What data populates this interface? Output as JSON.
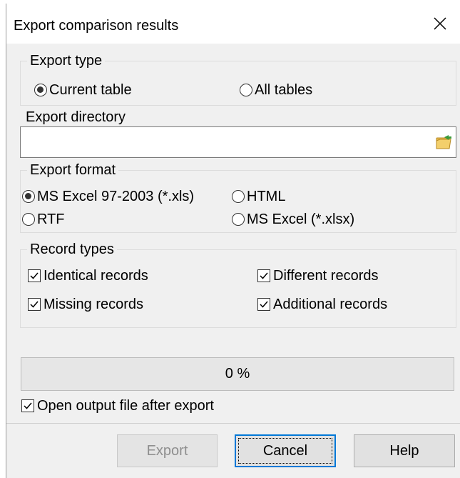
{
  "dialog": {
    "title": "Export comparison results"
  },
  "export_type": {
    "legend": "Export type",
    "options": [
      {
        "label": "Current table",
        "selected": true
      },
      {
        "label": "All tables",
        "selected": false
      }
    ]
  },
  "export_directory": {
    "label": "Export directory",
    "value": ""
  },
  "export_format": {
    "legend": "Export format",
    "options": [
      {
        "label": "MS Excel 97-2003 (*.xls)",
        "selected": true
      },
      {
        "label": "HTML",
        "selected": false
      },
      {
        "label": "RTF",
        "selected": false
      },
      {
        "label": "MS Excel (*.xlsx)",
        "selected": false
      }
    ]
  },
  "record_types": {
    "legend": "Record types",
    "options": [
      {
        "label": "Identical records",
        "checked": true
      },
      {
        "label": "Different records",
        "checked": true
      },
      {
        "label": "Missing records",
        "checked": true
      },
      {
        "label": "Additional records",
        "checked": true
      }
    ]
  },
  "progress": {
    "text": "0 %",
    "value": 0
  },
  "open_after": {
    "label": "Open output file after export",
    "checked": true
  },
  "buttons": {
    "export": "Export",
    "cancel": "Cancel",
    "help": "Help"
  },
  "colors": {
    "focus_border": "#0078d7",
    "dialog_bg": "#f0f0f0"
  }
}
